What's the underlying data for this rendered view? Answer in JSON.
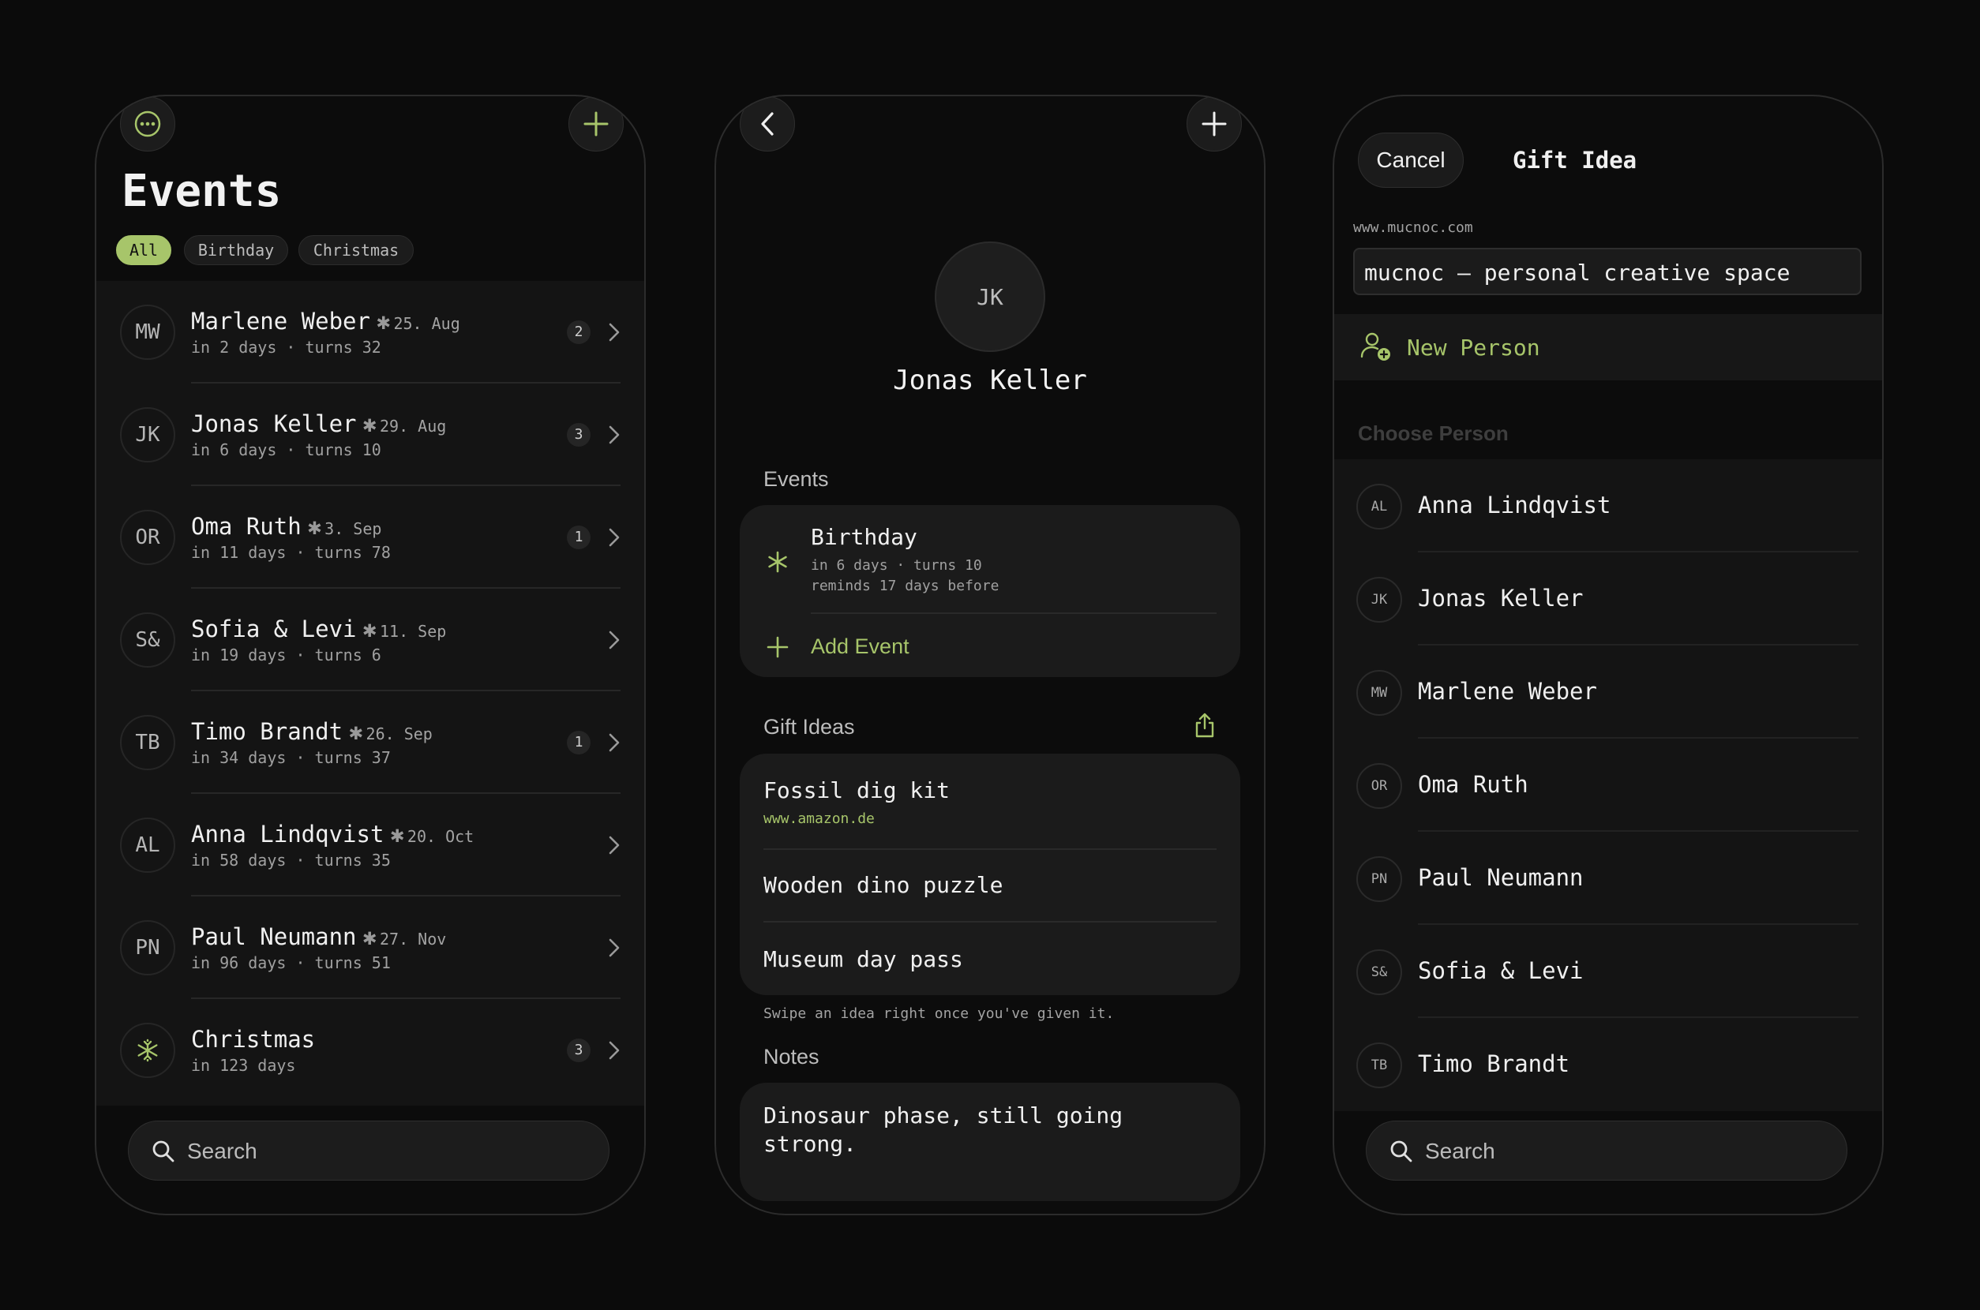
{
  "colors": {
    "accent": "#a7c56a",
    "background": "#0b0b0b",
    "surface": "#1b1b1b"
  },
  "events_screen": {
    "title": "Events",
    "filters": [
      {
        "label": "All",
        "active": true
      },
      {
        "label": "Birthday",
        "active": false
      },
      {
        "label": "Christmas",
        "active": false
      }
    ],
    "rows": [
      {
        "initials": "MW",
        "name": "Marlene Weber",
        "date": "25. Aug",
        "sub": "in 2 days · turns 32",
        "count": "2"
      },
      {
        "initials": "JK",
        "name": "Jonas Keller",
        "date": "29. Aug",
        "sub": "in 6 days · turns 10",
        "count": "3"
      },
      {
        "initials": "OR",
        "name": "Oma Ruth",
        "date": "3. Sep",
        "sub": "in 11 days · turns 78",
        "count": "1"
      },
      {
        "initials": "S&",
        "name": "Sofia & Levi",
        "date": "11. Sep",
        "sub": "in 19 days · turns 6",
        "count": ""
      },
      {
        "initials": "TB",
        "name": "Timo Brandt",
        "date": "26. Sep",
        "sub": "in 34 days · turns 37",
        "count": "1"
      },
      {
        "initials": "AL",
        "name": "Anna Lindqvist",
        "date": "20. Oct",
        "sub": "in 58 days · turns 35",
        "count": ""
      },
      {
        "initials": "PN",
        "name": "Paul Neumann",
        "date": "27. Nov",
        "sub": "in 96 days · turns 51",
        "count": ""
      }
    ],
    "christmas": {
      "name": "Christmas",
      "sub": "in 123 days",
      "count": "3"
    },
    "search_placeholder": "Search"
  },
  "person_screen": {
    "initials": "JK",
    "name": "Jonas Keller",
    "events_header": "Events",
    "event": {
      "title": "Birthday",
      "line1": "in 6 days · turns 10",
      "line2": "reminds 17 days before"
    },
    "add_event_label": "Add Event",
    "gift_header": "Gift Ideas",
    "gifts": [
      {
        "title": "Fossil dig kit",
        "link": "www.amazon.de"
      },
      {
        "title": "Wooden dino puzzle"
      },
      {
        "title": "Museum day pass"
      }
    ],
    "gift_hint": "Swipe an idea right once you've given it.",
    "notes_header": "Notes",
    "notes": "Dinosaur phase, still going strong."
  },
  "gift_screen": {
    "cancel_label": "Cancel",
    "title": "Gift Idea",
    "url_label": "www.mucnoc.com",
    "name_value": "mucnoc — personal creative space",
    "new_person_label": "New Person",
    "choose_header": "Choose Person",
    "people": [
      {
        "initials": "AL",
        "name": "Anna Lindqvist"
      },
      {
        "initials": "JK",
        "name": "Jonas Keller"
      },
      {
        "initials": "MW",
        "name": "Marlene Weber"
      },
      {
        "initials": "OR",
        "name": "Oma Ruth"
      },
      {
        "initials": "PN",
        "name": "Paul Neumann"
      },
      {
        "initials": "S&",
        "name": "Sofia & Levi"
      },
      {
        "initials": "TB",
        "name": "Timo Brandt"
      }
    ],
    "search_placeholder": "Search"
  }
}
